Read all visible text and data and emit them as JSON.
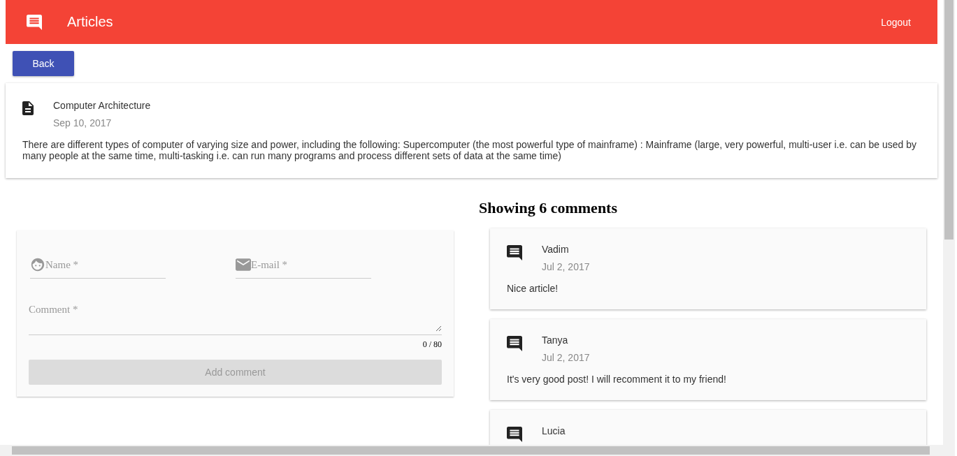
{
  "app_bar": {
    "title": "Articles",
    "logout": "Logout"
  },
  "back_button": "Back",
  "article": {
    "title": "Computer Architecture",
    "date": "Sep 10, 2017",
    "body": "There are different types of computer of varying size and power, including the following: Supercomputer (the most powerful type of mainframe) : Mainframe (large, very powerful, multi-user i.e. can be used by many people at the same time, multi-tasking i.e. can run many programs and process different sets of data at the same time)"
  },
  "comment_form": {
    "name": {
      "placeholder": "Name *"
    },
    "email": {
      "placeholder": "E-mail *"
    },
    "comment": {
      "placeholder": "Comment *"
    },
    "counter": "0 / 80",
    "submit": {
      "label": "Add comment",
      "disabled": true
    }
  },
  "comments_heading": "Showing 6 comments",
  "comments": [
    {
      "author": "Vadim",
      "date": "Jul 2, 2017",
      "text": "Nice article!"
    },
    {
      "author": "Tanya",
      "date": "Jul 2, 2017",
      "text": "It's very good post! I will recomment it to my friend!"
    },
    {
      "author": "Lucia"
    }
  ]
}
